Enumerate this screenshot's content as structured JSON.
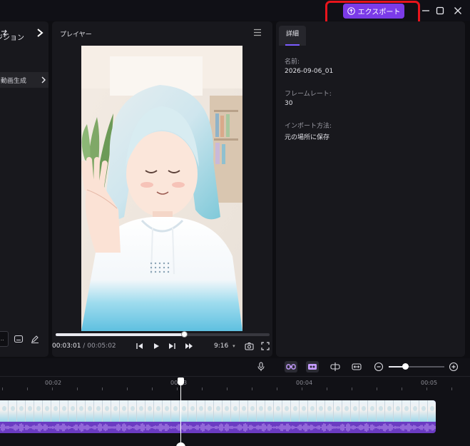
{
  "titlebar": {
    "export_label": "エクスポート"
  },
  "left_panel": {
    "transition_label": "ジション",
    "generate_label": "ら動画生成",
    "small_box_text": "..."
  },
  "player": {
    "title": "プレイヤー",
    "current_time": "00:03:01",
    "separator": "/",
    "duration": "00:05:02",
    "aspect_ratio": "9:16",
    "progress_fraction": 0.6
  },
  "detail": {
    "tab_label": "詳細",
    "fields": [
      {
        "label": "名前:",
        "value": "2026-09-06_01"
      },
      {
        "label": "フレームレート:",
        "value": "30"
      },
      {
        "label": "インポート方法:",
        "value": "元の場所に保存"
      }
    ]
  },
  "timeline": {
    "ruler_labels": [
      "00:02",
      "00:03",
      "00:04",
      "00:05"
    ],
    "zoom_fraction": 0.3
  },
  "colors": {
    "accent": "#7b3be8",
    "highlight": "#e8141c",
    "track": "#6b3bc2"
  }
}
